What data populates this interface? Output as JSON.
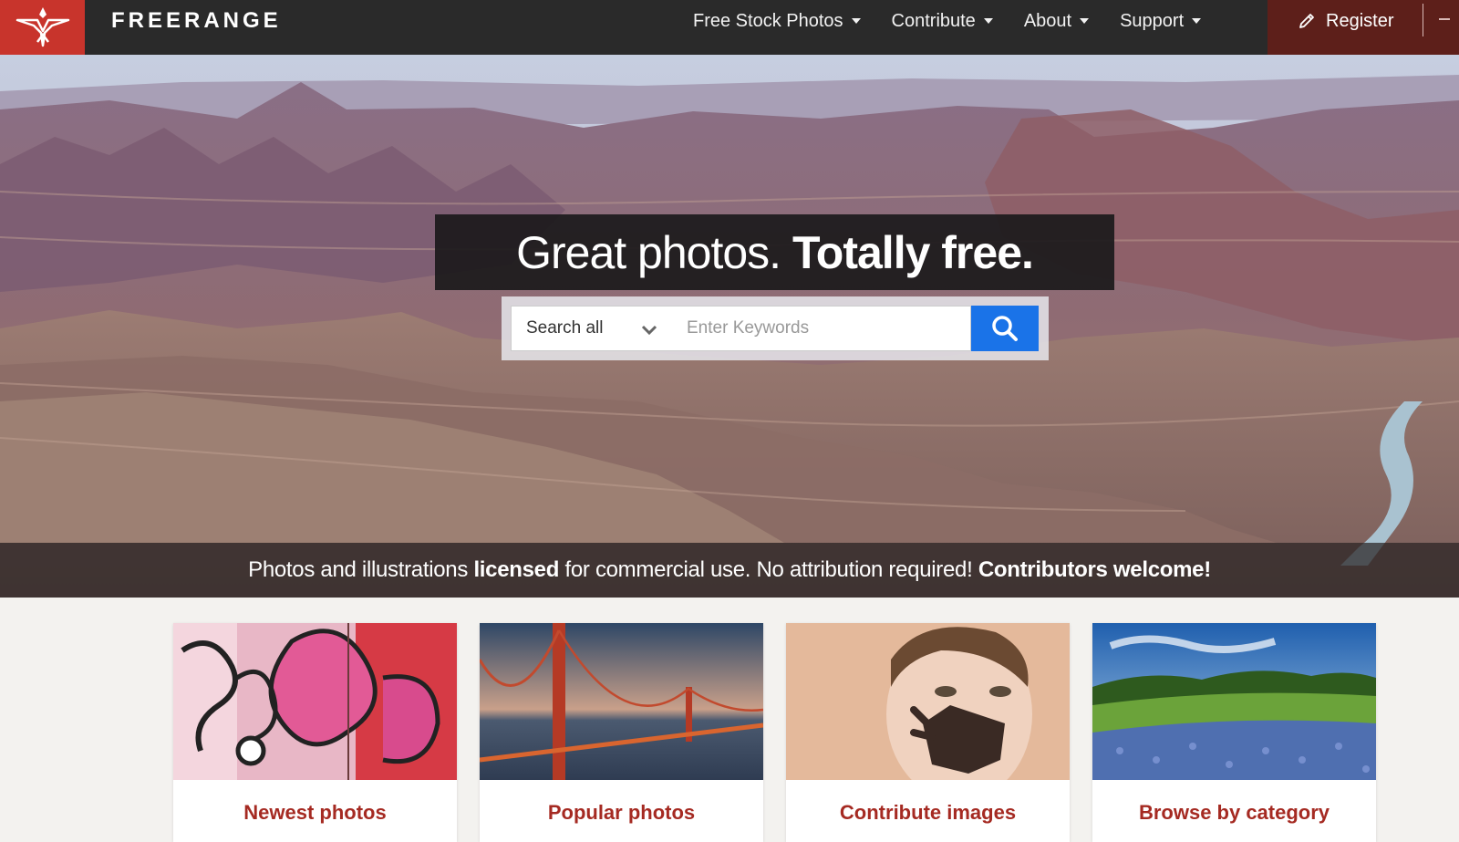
{
  "nav": {
    "brand": "FREERANGE",
    "menu": [
      {
        "label": "Free Stock Photos"
      },
      {
        "label": "Contribute"
      },
      {
        "label": "About"
      },
      {
        "label": "Support"
      }
    ],
    "register_label": "Register"
  },
  "hero": {
    "headline_regular": "Great photos.",
    "headline_bold": "Totally free.",
    "search": {
      "select_value": "Search all",
      "placeholder": "Enter Keywords"
    },
    "tagline": {
      "part1": "Photos and illustrations ",
      "bold1": "licensed",
      "part2": " for commercial use. No attribution required! ",
      "bold2": "Contributors welcome!"
    }
  },
  "cards": [
    {
      "title": "Newest photos"
    },
    {
      "title": "Popular photos"
    },
    {
      "title": "Contribute images"
    },
    {
      "title": "Browse by category"
    }
  ],
  "colors": {
    "navbar": "#2a2a2a",
    "brand_red": "#c8342c",
    "register_bg": "#5d1f1a",
    "search_button": "#1a73e8",
    "card_title": "#a52a22"
  }
}
